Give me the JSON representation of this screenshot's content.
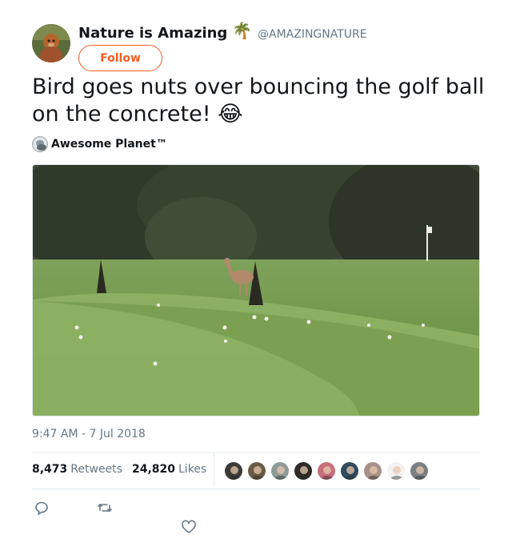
{
  "author": {
    "display_name": "Nature is Amazing",
    "name_emoji": "🌴",
    "handle": "@AMAZINGNATURE"
  },
  "follow_label": "Follow",
  "tweet": {
    "text": "Bird goes nuts over bouncing the golf ball on the concrete!",
    "emoji": "😂"
  },
  "via": {
    "name": "Awesome Planet™"
  },
  "timestamp": "9:47 AM - 7 Jul 2018",
  "stats": {
    "retweets_count": "8,473",
    "retweets_label": "Retweets",
    "likes_count": "24,820",
    "likes_label": "Likes"
  },
  "likers": [
    {
      "icon": "liker-avatar",
      "color": "#3b3a36"
    },
    {
      "icon": "liker-avatar",
      "color": "#6b5a45"
    },
    {
      "icon": "liker-avatar",
      "color": "#8f9a96"
    },
    {
      "icon": "liker-avatar",
      "color": "#2e2a26"
    },
    {
      "icon": "liker-avatar",
      "color": "#c86e7a"
    },
    {
      "icon": "liker-avatar",
      "color": "#2f4a5c"
    },
    {
      "icon": "liker-avatar",
      "color": "#a8918a"
    },
    {
      "icon": "liker-avatar",
      "color": "#f2f2f2"
    },
    {
      "icon": "liker-avatar",
      "color": "#7a7f82"
    }
  ],
  "actions": [
    {
      "icon": "reply-icon"
    },
    {
      "icon": "retweet-icon"
    },
    {
      "icon": "heart-icon"
    }
  ],
  "colors": {
    "accent": "#f45d22",
    "text": "#14171a",
    "muted": "#657786",
    "icon": "#657786"
  }
}
